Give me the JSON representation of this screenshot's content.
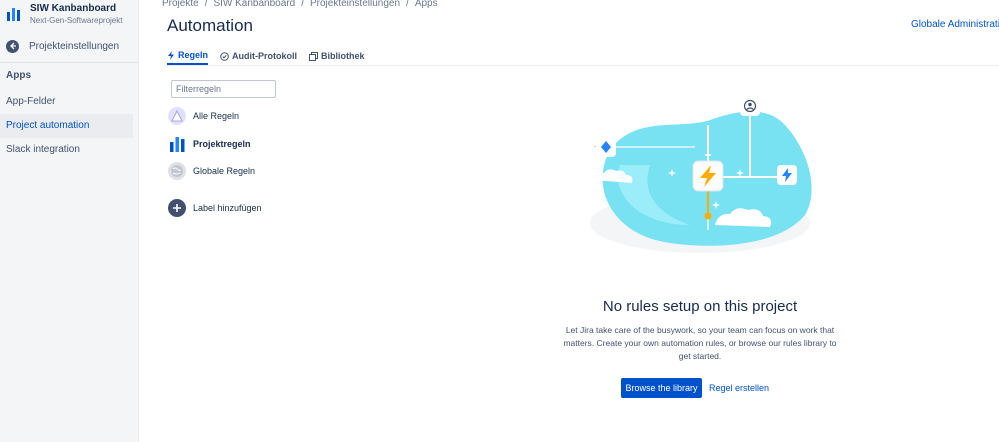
{
  "sidebar": {
    "project": {
      "name": "SIW Kanbanboard",
      "type": "Next-Gen-Softwareprojekt"
    },
    "back_label": "Projekteinstellungen",
    "section_heading": "Apps",
    "items": [
      {
        "label": "App-Felder",
        "active": false
      },
      {
        "label": "Project automation",
        "active": true
      },
      {
        "label": "Slack integration",
        "active": false
      }
    ]
  },
  "header": {
    "breadcrumb": [
      "Projekte",
      "SIW Kanbanboard",
      "Projekteinstellungen",
      "Apps"
    ],
    "breadcrumb_separator": "/",
    "title": "Automation",
    "global_admin": "Globale Administration"
  },
  "tabs": [
    {
      "label": "Regeln",
      "icon": "bolt-icon",
      "active": true
    },
    {
      "label": "Audit-Protokoll",
      "icon": "check-circle-icon",
      "active": false
    },
    {
      "label": "Bibliothek",
      "icon": "copy-icon",
      "active": false
    }
  ],
  "filter": {
    "placeholder": "Filterregeln",
    "value": ""
  },
  "rule_groups": [
    {
      "label": "Alle Regeln",
      "icon": "all-rules-icon",
      "bold": false
    },
    {
      "label": "Projektregeln",
      "icon": "project-rules-icon",
      "bold": true
    },
    {
      "label": "Globale Regeln",
      "icon": "globe-icon",
      "bold": false
    }
  ],
  "add_label": "Label hinzufügen",
  "empty_state": {
    "title": "No rules setup on this project",
    "description": "Let Jira take care of the busywork, so your team can focus on work that matters. Create your own automation rules, or browse our rules library to get started.",
    "primary_button": "Browse the library",
    "secondary_link": "Regel erstellen"
  },
  "colors": {
    "primary": "#0052cc",
    "sidebar_bg": "#f4f5f7",
    "text": "#172b4d",
    "muted": "#6b778c",
    "illustration_cyan": "#79e2f2",
    "bolt_orange": "#ffab00"
  }
}
